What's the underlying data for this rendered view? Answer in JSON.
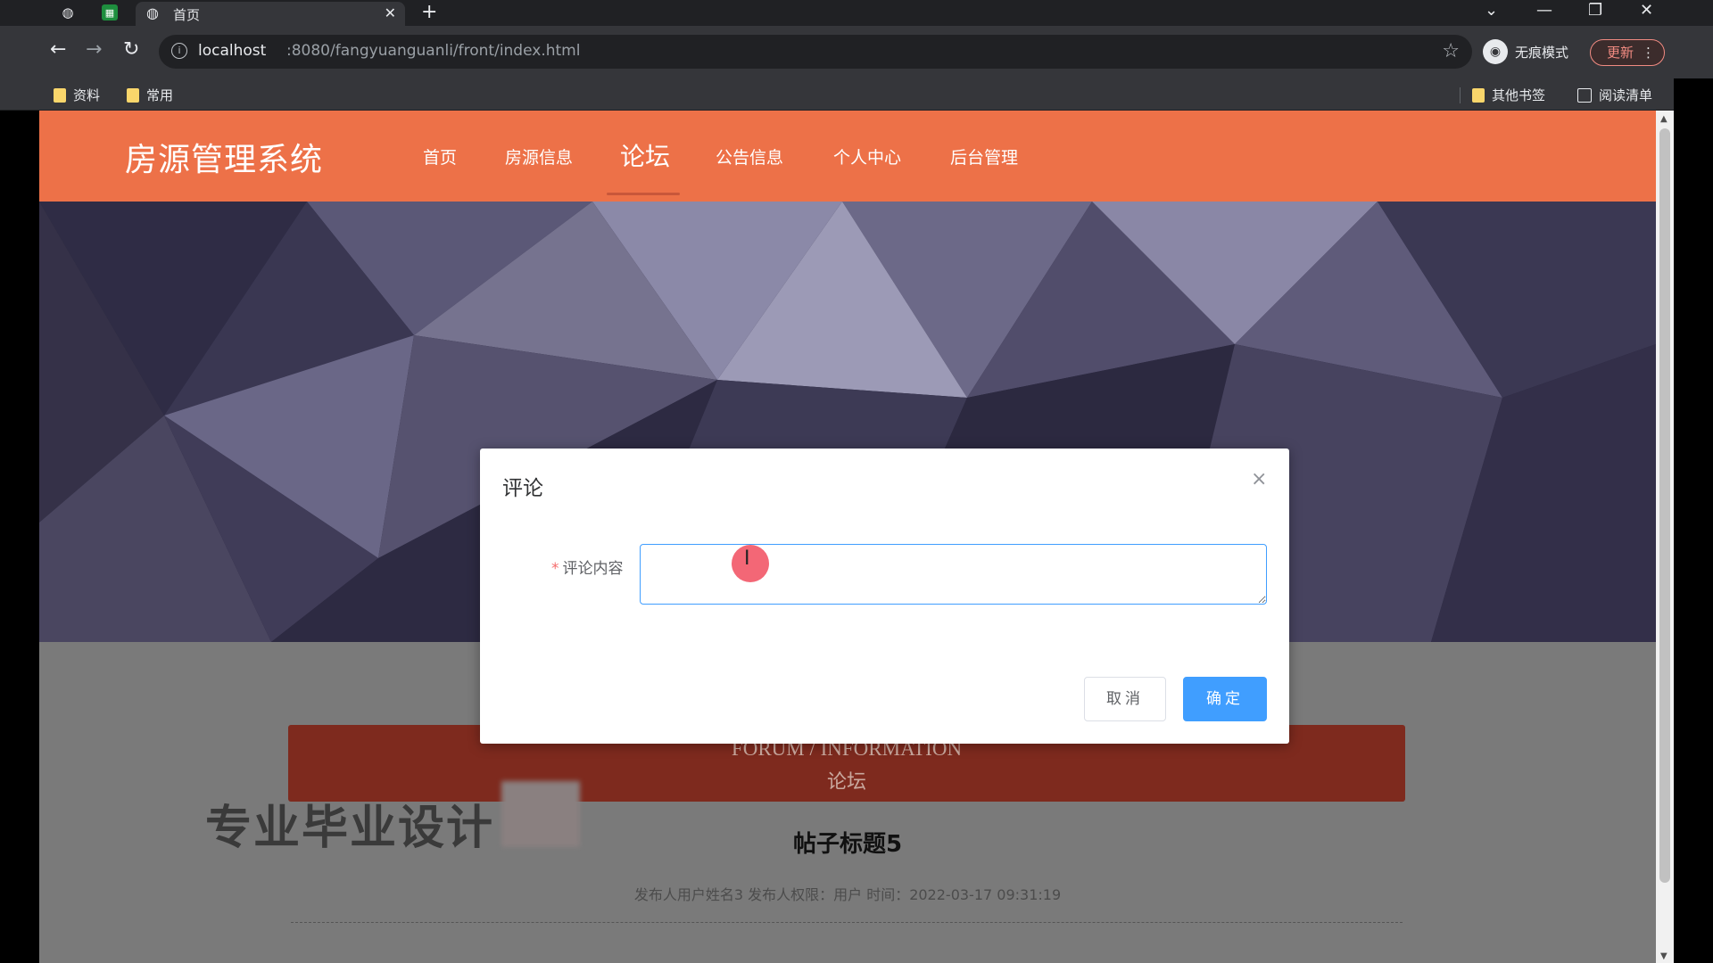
{
  "browser": {
    "tab": {
      "title": "首页"
    },
    "new_tab_glyph": "+",
    "address": {
      "host": "localhost",
      "path": ":8080/fangyuanguanli/front/index.html"
    },
    "incognito_label": "无痕模式",
    "update_label": "更新",
    "bookmarks": [
      {
        "label": "资料"
      },
      {
        "label": "常用"
      }
    ],
    "other_bookmarks_label": "其他书签",
    "reading_list_label": "阅读清单"
  },
  "site": {
    "title": "房源管理系统",
    "nav": [
      {
        "label": "首页"
      },
      {
        "label": "房源信息"
      },
      {
        "label": "论坛"
      },
      {
        "label": "公告信息"
      },
      {
        "label": "个人中心"
      },
      {
        "label": "后台管理"
      }
    ],
    "active_nav_index": 2,
    "carousel": {
      "count": 3,
      "active_index": 0
    },
    "section": {
      "title_en": "FORUM / INFORMATION",
      "title_cn": "论坛"
    },
    "watermark": "专业毕业设计",
    "post": {
      "title": "帖子标题5",
      "meta": "发布人用户姓名3   发布人权限：用户   时间：2022-03-17 09:31:19"
    }
  },
  "modal": {
    "title": "评论",
    "close_glyph": "×",
    "field_label": "评论内容",
    "required_mark": "*",
    "input_value": "",
    "cancel_label": "取消",
    "confirm_label": "确定"
  },
  "colors": {
    "header": "#ed7148",
    "section_bar": "#7e2a1e",
    "primary": "#409eff",
    "required": "#f56c6c"
  }
}
